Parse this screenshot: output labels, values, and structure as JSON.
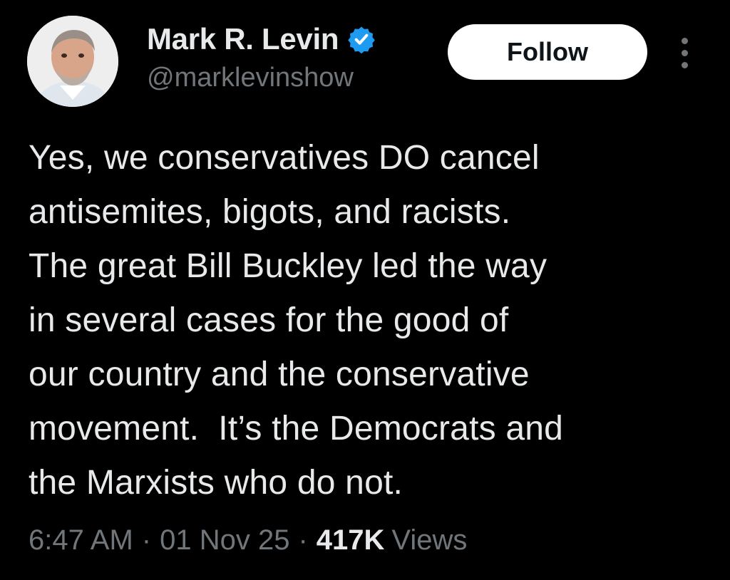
{
  "author": {
    "display_name": "Mark R. Levin",
    "handle": "@marklevinshow",
    "verified": true,
    "verified_color": "#1d9bf0"
  },
  "actions": {
    "follow_label": "Follow",
    "more_icon": "more-vertical-icon"
  },
  "tweet": {
    "lines": [
      "Yes, we conservatives DO cancel",
      "antisemites, bigots, and racists.",
      "The great Bill Buckley led the way",
      "in several cases for the good of",
      "our country and the conservative",
      "movement.  It’s the Democrats and",
      "the Marxists who do not."
    ]
  },
  "meta": {
    "time": "6:47 AM",
    "separator": "·",
    "date": "01 Nov 25",
    "views_count": "417K",
    "views_label": "Views"
  },
  "colors": {
    "background": "#000000",
    "primary_text": "#e7e9ea",
    "secondary_text": "#71767b",
    "follow_bg": "#ffffff"
  }
}
